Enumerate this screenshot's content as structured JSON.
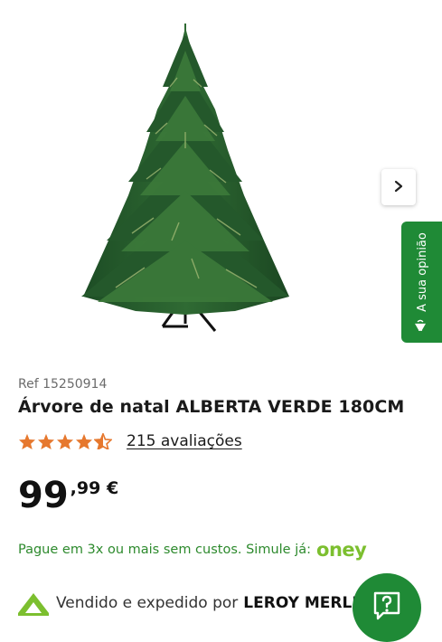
{
  "product": {
    "ref": "Ref 15250914",
    "title": "Árvore de natal ALBERTA VERDE 180CM",
    "rating_value": 4.5,
    "rating_max": 5,
    "reviews_label": "215 avaliações",
    "price_integer": "99",
    "price_decimal": ",99 €",
    "installments_text": "Pague em 3x ou mais sem custos. Simule já:",
    "installments_brand": "oney",
    "seller_prefix": "Vendido e expedido por",
    "seller_name": "LEROY MERLIN"
  },
  "side_tab": {
    "label": "A sua opinião"
  },
  "icons": {
    "gallery_next": "chevron-right-icon",
    "opinion": "megaphone-icon",
    "help": "question-chat-icon",
    "seller_logo": "leroy-merlin-logo"
  },
  "colors": {
    "brand_green": "#1f8a36",
    "star": "#e6782e",
    "installments_text": "#2d8a2d",
    "oney": "#7cbf2f"
  }
}
